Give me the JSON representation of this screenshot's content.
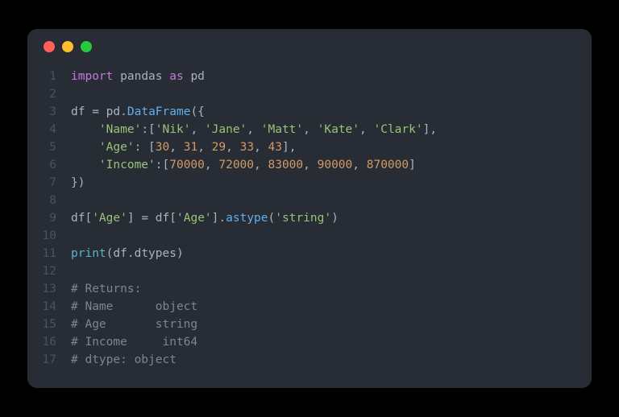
{
  "titlebar": {
    "close": "close",
    "minimize": "minimize",
    "zoom": "zoom"
  },
  "lines": {
    "l1": {
      "num": "1",
      "kw_import": "import",
      "mod": "pandas",
      "kw_as": "as",
      "alias": "pd"
    },
    "l2": {
      "num": "2"
    },
    "l3": {
      "num": "3",
      "var": "df",
      "eq": " = ",
      "pd": "pd",
      "dot": ".",
      "fn": "DataFrame",
      "open": "({"
    },
    "l4": {
      "num": "4",
      "indent": "    ",
      "key": "'Name'",
      "colon": ":[",
      "v1": "'Nik'",
      "c": ", ",
      "v2": "'Jane'",
      "v3": "'Matt'",
      "v4": "'Kate'",
      "v5": "'Clark'",
      "close": "],"
    },
    "l5": {
      "num": "5",
      "indent": "    ",
      "key": "'Age'",
      "colon": ": [",
      "n1": "30",
      "c": ", ",
      "n2": "31",
      "n3": "29",
      "n4": "33",
      "n5": "43",
      "close": "],"
    },
    "l6": {
      "num": "6",
      "indent": "    ",
      "key": "'Income'",
      "colon": ":[",
      "n1": "70000",
      "c": ", ",
      "n2": "72000",
      "n3": "83000",
      "n4": "90000",
      "n5": "870000",
      "close": "]"
    },
    "l7": {
      "num": "7",
      "close": "})"
    },
    "l8": {
      "num": "8"
    },
    "l9": {
      "num": "9",
      "var": "df",
      "open": "[",
      "key": "'Age'",
      "close1": "] ",
      "eq": "= ",
      "var2": "df",
      "open2": "[",
      "key2": "'Age'",
      "close2": "].",
      "method": "astype",
      "paren": "(",
      "arg": "'string'",
      "paren2": ")"
    },
    "l10": {
      "num": "10"
    },
    "l11": {
      "num": "11",
      "fn": "print",
      "paren": "(",
      "var": "df",
      "dot": ".",
      "attr": "dtypes",
      "paren2": ")"
    },
    "l12": {
      "num": "12"
    },
    "l13": {
      "num": "13",
      "text": "# Returns:"
    },
    "l14": {
      "num": "14",
      "text": "# Name      object"
    },
    "l15": {
      "num": "15",
      "text": "# Age       string"
    },
    "l16": {
      "num": "16",
      "text": "# Income     int64"
    },
    "l17": {
      "num": "17",
      "text": "# dtype: object"
    }
  }
}
